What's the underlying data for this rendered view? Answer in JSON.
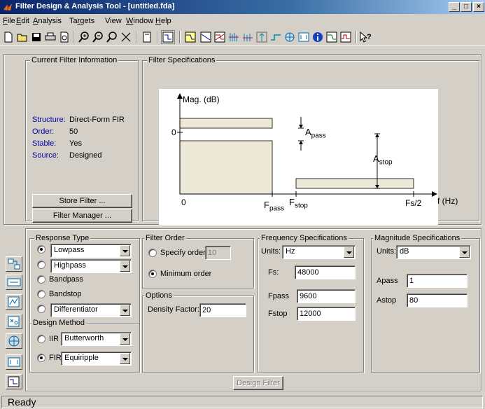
{
  "window": {
    "title": "Filter Design & Analysis Tool - [untitled.fda]",
    "buttons": {
      "minimize": "_",
      "maximize": "□",
      "close": "×"
    }
  },
  "menu": [
    {
      "label": "File",
      "u": "F",
      "rest": "ile"
    },
    {
      "label": "Edit",
      "u": "E",
      "rest": "dit"
    },
    {
      "label": "Analysis",
      "u": "A",
      "rest": "nalysis"
    },
    {
      "label": "Targets",
      "pre": "Ta",
      "u": "r",
      "rest": "gets"
    },
    {
      "label": "View"
    },
    {
      "label": "Window",
      "u": "W",
      "rest": "indow"
    },
    {
      "label": "Help",
      "u": "H",
      "rest": "elp"
    }
  ],
  "current_filter": {
    "legend": "Current Filter Information",
    "rows": [
      {
        "key": "Structure:",
        "value": "Direct-Form FIR"
      },
      {
        "key": "Order:",
        "value": "50"
      },
      {
        "key": "Stable:",
        "value": "Yes"
      },
      {
        "key": "Source:",
        "value": "Designed"
      }
    ],
    "store_button": "Store Filter ...",
    "manager_button": "Filter Manager ..."
  },
  "filter_specs": {
    "legend": "Filter Specifications",
    "ylabel": "Mag. (dB)",
    "zero_y": "0",
    "zero_x": "0",
    "apass": "A",
    "apass_sub": "pass",
    "astop": "A",
    "astop_sub": "stop",
    "fpass": "F",
    "fpass_sub": "pass",
    "fstop": "F",
    "fstop_sub": "stop",
    "fs2": "Fs/2",
    "fhz": "f (Hz)"
  },
  "response_type": {
    "legend": "Response Type",
    "options": [
      {
        "label": "Lowpass",
        "selected": true,
        "combo": true
      },
      {
        "label": "Highpass",
        "selected": false,
        "combo": true
      },
      {
        "label": "Bandpass",
        "selected": false
      },
      {
        "label": "Bandstop",
        "selected": false
      },
      {
        "label": "Differentiator",
        "selected": false,
        "combo": true
      }
    ]
  },
  "design_method": {
    "legend": "Design Method",
    "iir_label": "IIR",
    "iir_value": "Butterworth",
    "fir_label": "FIR",
    "fir_value": "Equiripple",
    "selected": "FIR"
  },
  "filter_order": {
    "legend": "Filter Order",
    "specify_label": "Specify order:",
    "specify_value": "10",
    "minimum_label": "Minimum order",
    "selected": "minimum"
  },
  "options": {
    "legend": "Options",
    "density_label": "Density Factor:",
    "density_value": "20"
  },
  "frequency_specs": {
    "legend": "Frequency Specifications",
    "units_label": "Units:",
    "units_value": "Hz",
    "fs_label": "Fs:",
    "fs_value": "48000",
    "fpass_label": "Fpass",
    "fpass_value": "9600",
    "fstop_label": "Fstop",
    "fstop_value": "12000"
  },
  "magnitude_specs": {
    "legend": "Magnitude Specifications",
    "units_label": "Units:",
    "units_value": "dB",
    "apass_label": "Apass",
    "apass_value": "1",
    "astop_label": "Astop",
    "astop_value": "80"
  },
  "design_button": "Design Filter",
  "status": "Ready"
}
